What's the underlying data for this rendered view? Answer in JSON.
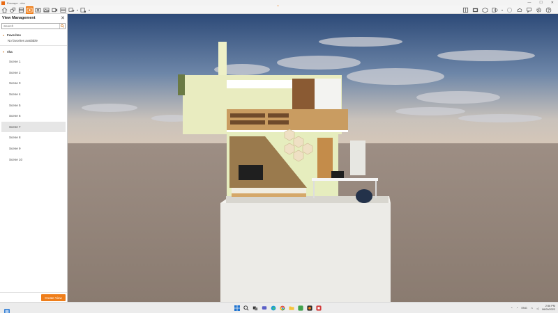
{
  "window": {
    "title": "Enscape - vha"
  },
  "panel": {
    "title": "View Management",
    "search_placeholder": "Search",
    "favorites_label": "Favorites",
    "favorites_empty": "No favorites available",
    "group_label": "vha",
    "scenes": [
      "Scene 1",
      "Scene 2",
      "Scene 3",
      "Scene 4",
      "Scene 5",
      "Scene 6",
      "Scene 7",
      "Scene 8",
      "Scene 9",
      "Scene 10"
    ],
    "selected_scene": "Scene 7",
    "create_button": "Create View"
  },
  "taskbar": {
    "language": "ENG",
    "time": "2:56 PM",
    "date": "06/09/2022"
  },
  "colors": {
    "accent": "#ef7e1a",
    "panel_bg": "#ffffff",
    "selected_row": "#e6e6e6"
  },
  "icons": {
    "toolbar_left": [
      "home-icon",
      "assets-icon",
      "library-icon",
      "view-management-icon",
      "screenshot-icon",
      "panorama-icon",
      "video-icon",
      "batch-render-icon",
      "export-icon",
      "settings-group-icon"
    ],
    "toolbar_right": [
      "capture-icon",
      "presentation-icon",
      "vr-icon",
      "bookmark-icon",
      "share-icon",
      "upload-icon",
      "feedback-icon",
      "settings-icon",
      "help-icon"
    ]
  }
}
